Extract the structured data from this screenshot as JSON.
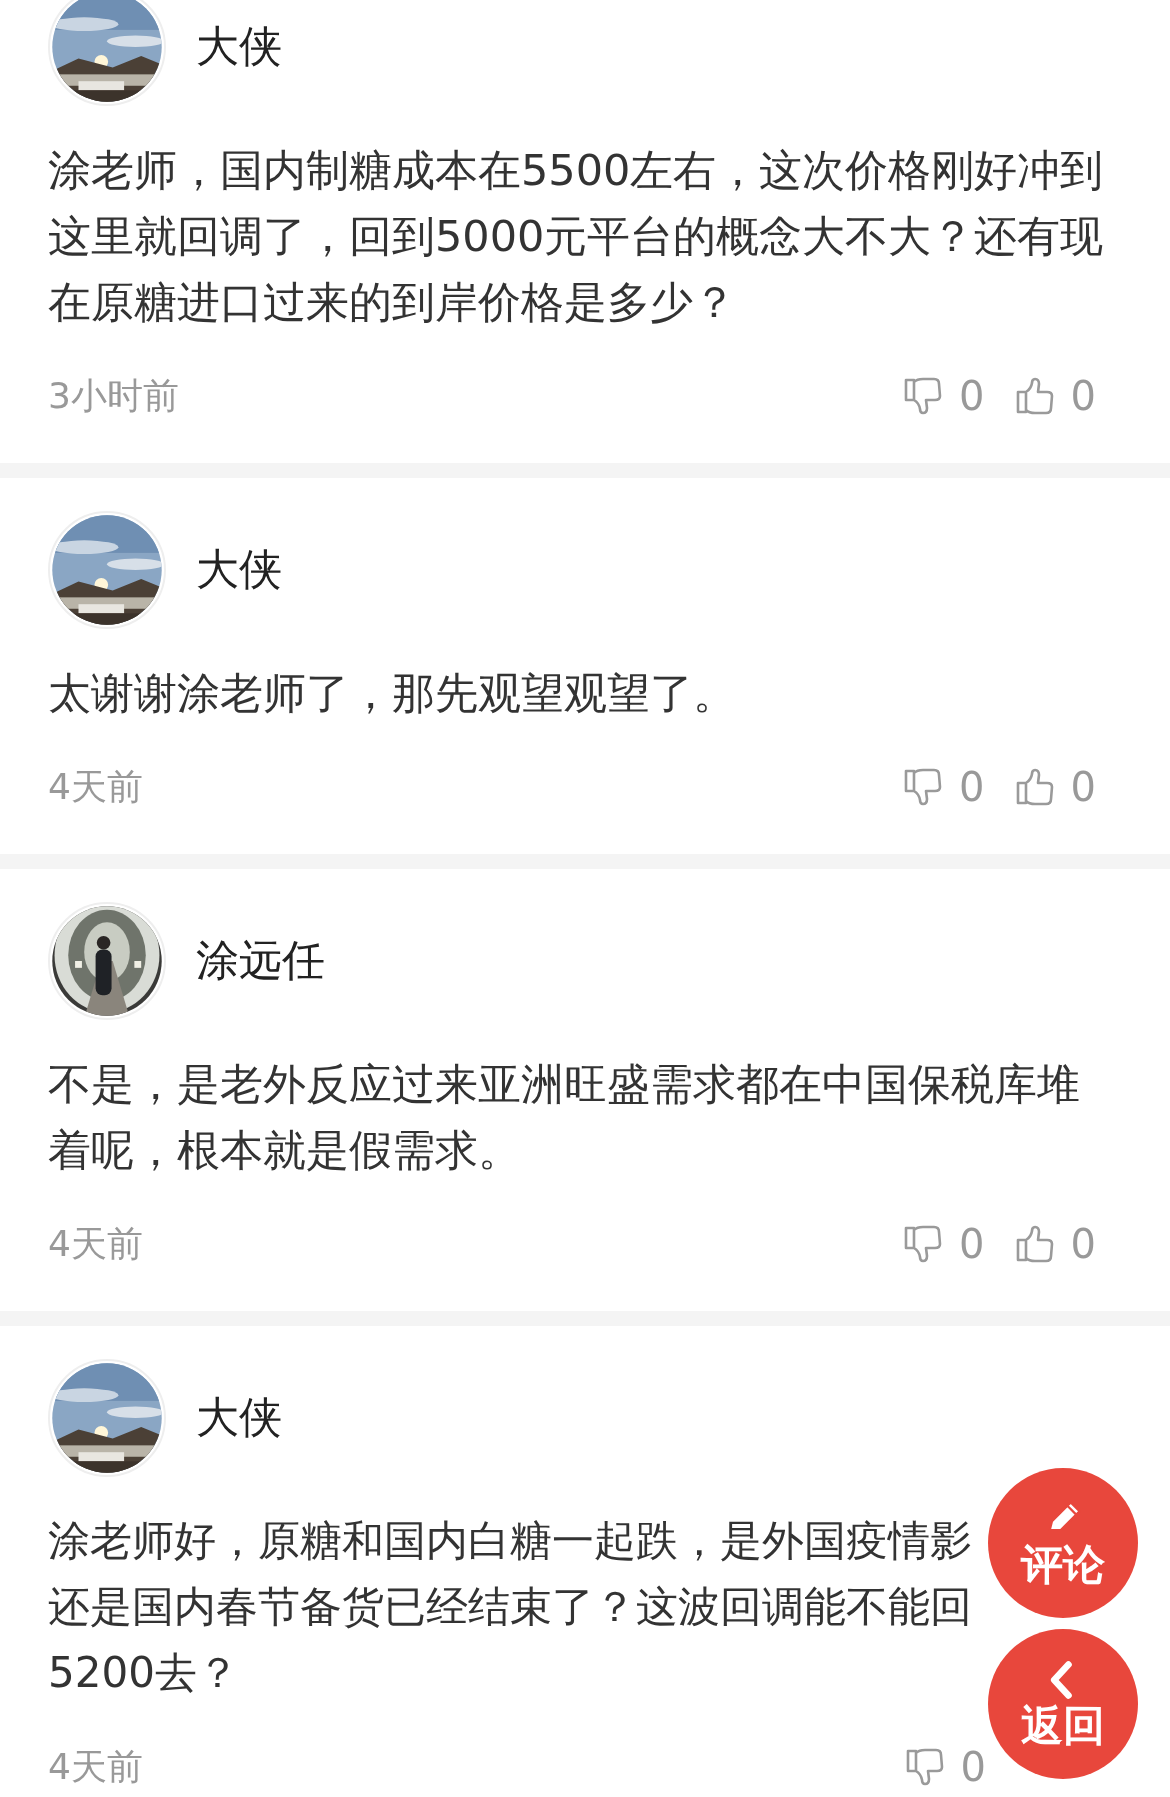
{
  "comments": [
    {
      "author": "大侠",
      "text": "涂老师，国内制糖成本在5500左右，这次价格刚好冲到这里就回调了，回到5000元平台的概念大不大？还有现在原糖进口过来的到岸价格是多少？",
      "time": "3小时前",
      "dislikes": "0",
      "likes": "0"
    },
    {
      "author": "大侠",
      "text": "太谢谢涂老师了，那先观望观望了。",
      "time": "4天前",
      "dislikes": "0",
      "likes": "0"
    },
    {
      "author": "涂远任",
      "text": "不是，是老外反应过来亚洲旺盛需求都在中国保税库堆着呢，根本就是假需求。",
      "time": "4天前",
      "dislikes": "0",
      "likes": "0"
    },
    {
      "author": "大侠",
      "text": "涂老师好，原糖和国内白糖一起跌，是外国疫情影还是国内春节备货已经结束了？这波回调能不能回5200去？",
      "time": "4天前",
      "dislikes": "0"
    }
  ],
  "fab_buttons": [
    {
      "label": "评论",
      "kind": "edit"
    },
    {
      "label": "返回",
      "kind": "back"
    }
  ]
}
